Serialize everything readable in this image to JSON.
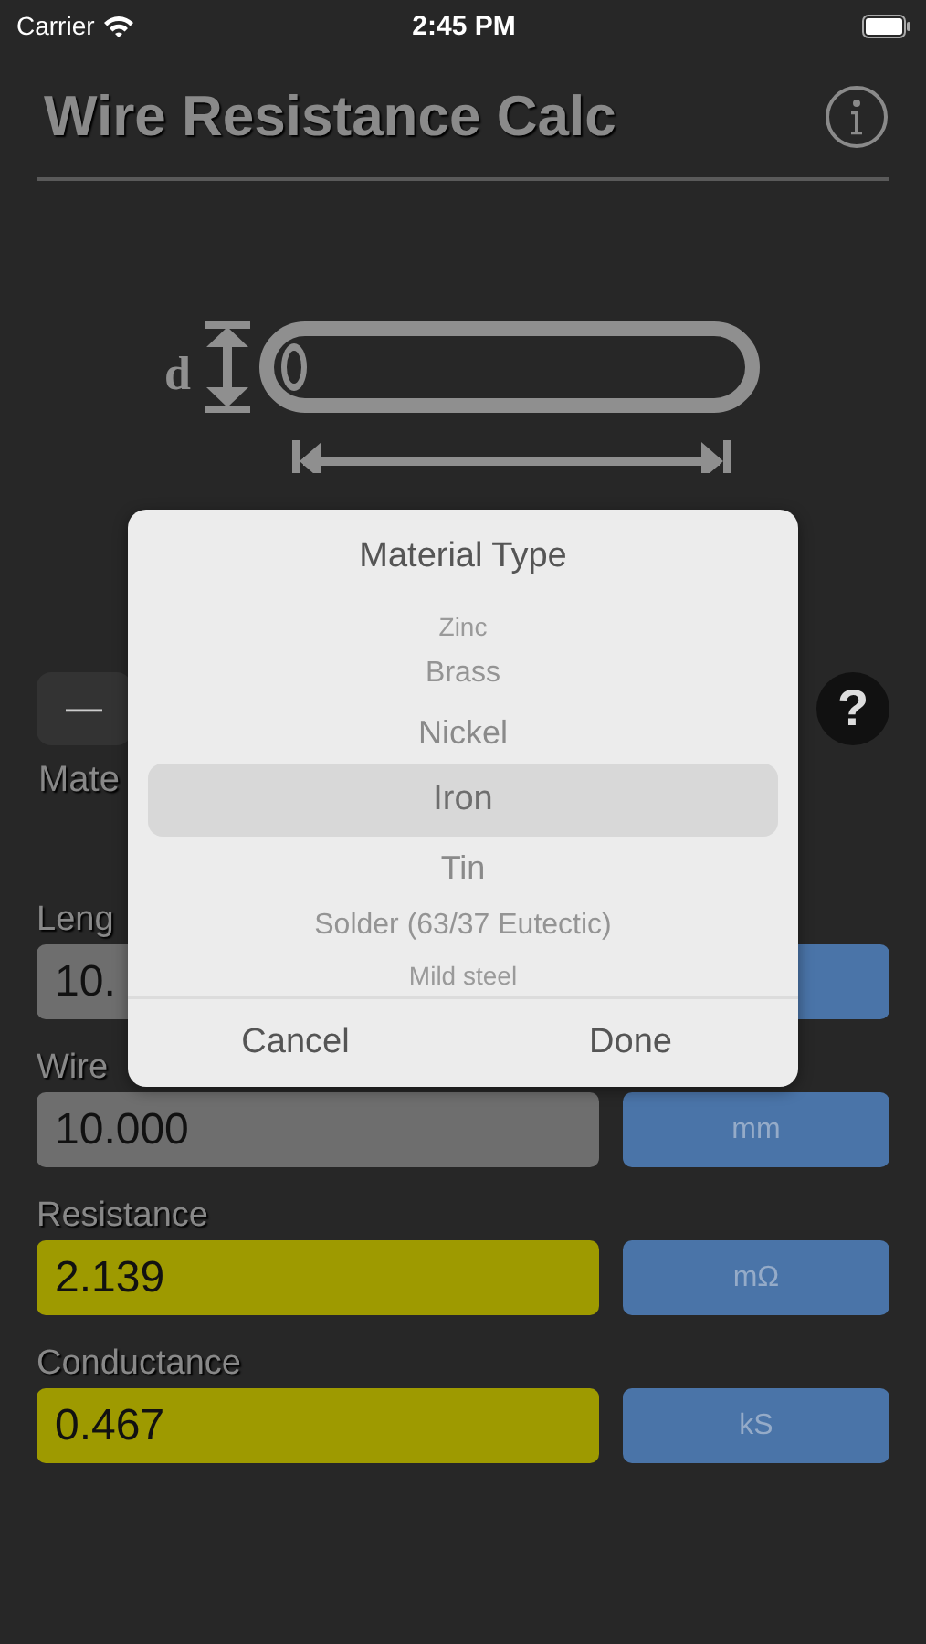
{
  "status_bar": {
    "carrier": "Carrier",
    "time": "2:45 PM"
  },
  "header": {
    "title": "Wire Resistance Calc"
  },
  "diagram": {
    "diameter_label": "d"
  },
  "selector": {
    "segment_label": "—",
    "help": "?"
  },
  "material_label": "Mate",
  "rows": [
    {
      "label": "Leng",
      "value": "10.",
      "kind": "input"
    },
    {
      "label": "Wire",
      "value": "10.000",
      "unit": "mm",
      "kind": "input"
    },
    {
      "label": "Resistance",
      "value": "2.139",
      "unit": "mΩ",
      "kind": "result"
    },
    {
      "label": "Conductance",
      "value": "0.467",
      "unit": "kS",
      "kind": "result"
    }
  ],
  "picker": {
    "title": "Material Type",
    "items": [
      {
        "label": "Zinc",
        "selected": false
      },
      {
        "label": "Brass",
        "selected": false
      },
      {
        "label": "Nickel",
        "selected": false
      },
      {
        "label": "Iron",
        "selected": true
      },
      {
        "label": "Tin",
        "selected": false
      },
      {
        "label": "Solder (63/37 Eutectic)",
        "selected": false
      },
      {
        "label": "Mild steel",
        "selected": false
      }
    ],
    "buttons": [
      "Cancel",
      "Done"
    ]
  }
}
